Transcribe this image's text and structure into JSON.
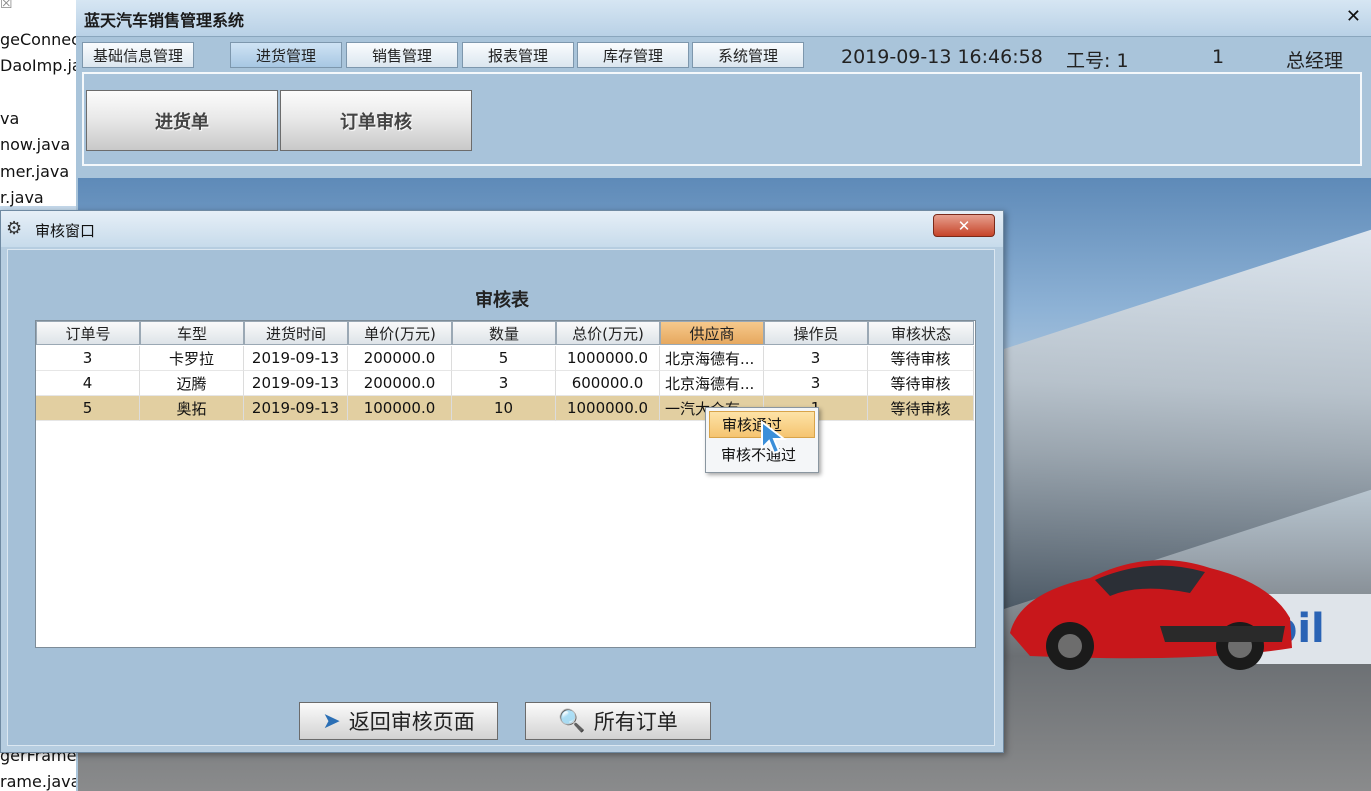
{
  "ide": {
    "close_glyph": "☒",
    "files": [
      "geConnec",
      "DaoImp.ja",
      "va",
      "now.java",
      "mer.java",
      "r.java",
      "gerFrame.j",
      "rame.java"
    ]
  },
  "window": {
    "title": "蓝天汽车销售管理系统",
    "close_glyph": "✕",
    "tabs": [
      "基础信息管理",
      "进货管理",
      "销售管理",
      "报表管理",
      "库存管理",
      "系统管理"
    ],
    "active_tab": "进货管理",
    "status": {
      "datetime": "2019-09-13 16:46:58",
      "staff_label": "工号: 1",
      "user_id": "1",
      "role": "总经理"
    },
    "buttons": {
      "purchase_order": "进货单",
      "order_review": "订单审核"
    }
  },
  "background": {
    "sign_text": "cbil"
  },
  "dialog": {
    "title": "审核窗口",
    "close_glyph": "✕",
    "table_title": "审核表",
    "columns": [
      "订单号",
      "车型",
      "进货时间",
      "单价(万元)",
      "数量",
      "总价(万元)",
      "供应商",
      "操作员",
      "审核状态"
    ],
    "selected_column": "供应商",
    "rows": [
      [
        "3",
        "卡罗拉",
        "2019-09-13",
        "200000.0",
        "5",
        "1000000.0",
        "北京海德有...",
        "3",
        "等待审核"
      ],
      [
        "4",
        "迈腾",
        "2019-09-13",
        "200000.0",
        "3",
        "600000.0",
        "北京海德有...",
        "3",
        "等待审核"
      ],
      [
        "5",
        "奥拓",
        "2019-09-13",
        "100000.0",
        "10",
        "1000000.0",
        "一汽大众有...",
        "1",
        "等待审核"
      ]
    ],
    "selected_row": 2,
    "context_menu": [
      "审核通过",
      "审核不通过"
    ],
    "buttons": {
      "back": "返回审核页面",
      "all_orders": "所有订单"
    }
  },
  "colors": {
    "window_bg": "#a9c4da",
    "selected_row": "#e2cfa1",
    "selected_header": "#e6a85f",
    "close_red": "#c6452a"
  }
}
